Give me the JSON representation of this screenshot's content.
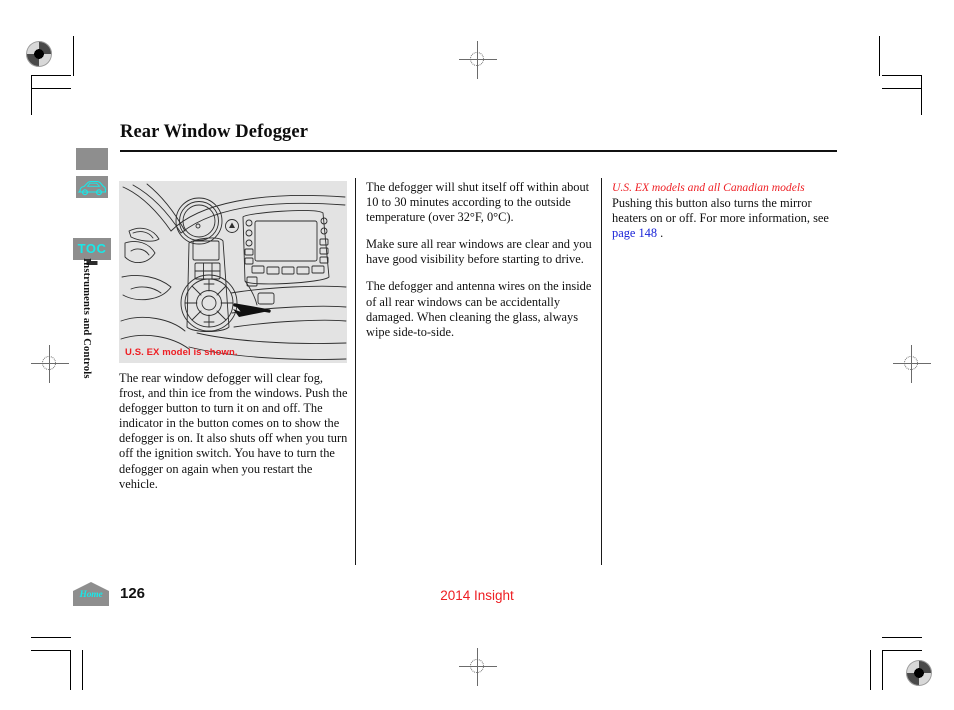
{
  "document": {
    "title": "Rear Window Defogger",
    "page_number": "126",
    "model_line": "2014 Insight"
  },
  "sidebar": {
    "tabs": [
      {
        "name": "info-tab",
        "icon": "info-icon",
        "label": ""
      },
      {
        "name": "vehicle-tab",
        "icon": "car-icon",
        "label": ""
      },
      {
        "name": "toc-tab",
        "icon": "toc-icon",
        "label": "TOC"
      }
    ],
    "section_label": "Instruments and Controls"
  },
  "figure": {
    "caption": "U.S. EX model is shown.",
    "alt": "Dashboard center console illustration with arrow pointing to the rear window defogger button"
  },
  "columns": {
    "left": [
      "The rear window defogger will clear fog, frost, and thin ice from the windows. Push the defogger button to turn it on and off. The indicator in the button comes on to show the defogger is on. It also shuts off when you turn off the ignition switch. You have to turn the defogger on again when you restart the vehicle."
    ],
    "middle": [
      "The defogger will shut itself off within about 10 to 30 minutes according to the outside temperature (over 32°F, 0°C).",
      "Make sure all rear windows are clear and you have good visibility before starting to drive.",
      "The defogger and antenna wires on the inside of all rear windows can be accidentally damaged. When cleaning the glass, always wipe side-to-side."
    ],
    "right": {
      "heading": "U.S. EX models and all Canadian models",
      "body_before_link": "Pushing this button also turns the mirror heaters on or off. For more information, see ",
      "link_text": "page 148",
      "body_after_link": " ."
    }
  },
  "footer": {
    "home_label": "Home"
  },
  "colors": {
    "accent_red": "#ee1d22",
    "link_blue": "#1a24d8",
    "tab_cyan": "#18e8e8",
    "tab_gray": "#8e8e8e",
    "figure_bg": "#e3e3e3"
  }
}
